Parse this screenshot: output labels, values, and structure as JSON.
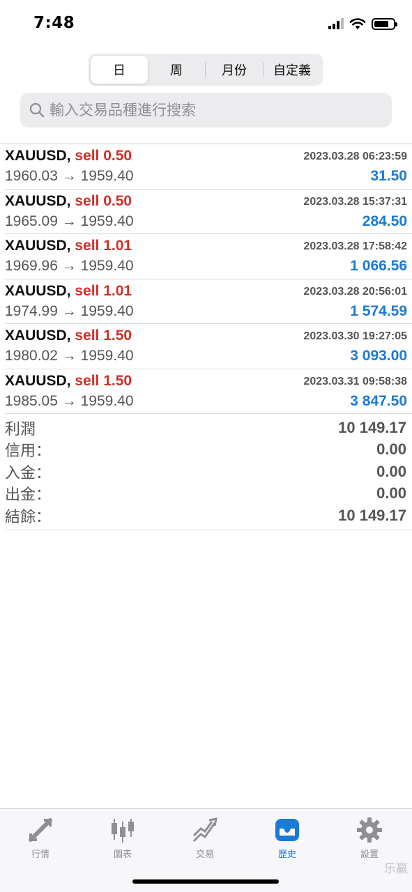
{
  "status": {
    "time": "7:48"
  },
  "segments": [
    "日",
    "周",
    "月份",
    "自定義"
  ],
  "active_segment": 0,
  "search": {
    "placeholder": "輸入交易品種進行搜索"
  },
  "trades": [
    {
      "symbol": "XAUUSD,",
      "side": "sell 0.50",
      "open": "1960.03",
      "arrow": "→",
      "close": "1959.40",
      "time": "2023.03.28 06:23:59",
      "profit": "31.50"
    },
    {
      "symbol": "XAUUSD,",
      "side": "sell 0.50",
      "open": "1965.09",
      "arrow": "→",
      "close": "1959.40",
      "time": "2023.03.28 15:37:31",
      "profit": "284.50"
    },
    {
      "symbol": "XAUUSD,",
      "side": "sell 1.01",
      "open": "1969.96",
      "arrow": "→",
      "close": "1959.40",
      "time": "2023.03.28 17:58:42",
      "profit": "1 066.56"
    },
    {
      "symbol": "XAUUSD,",
      "side": "sell 1.01",
      "open": "1974.99",
      "arrow": "→",
      "close": "1959.40",
      "time": "2023.03.28 20:56:01",
      "profit": "1 574.59"
    },
    {
      "symbol": "XAUUSD,",
      "side": "sell 1.50",
      "open": "1980.02",
      "arrow": "→",
      "close": "1959.40",
      "time": "2023.03.30 19:27:05",
      "profit": "3 093.00"
    },
    {
      "symbol": "XAUUSD,",
      "side": "sell 1.50",
      "open": "1985.05",
      "arrow": "→",
      "close": "1959.40",
      "time": "2023.03.31 09:58:38",
      "profit": "3 847.50"
    }
  ],
  "summary": [
    {
      "label": "利潤",
      "value": "10 149.17"
    },
    {
      "label": "信用：",
      "value": "0.00"
    },
    {
      "label": "入金：",
      "value": "0.00"
    },
    {
      "label": "出金：",
      "value": "0.00"
    },
    {
      "label": "結餘：",
      "value": "10 149.17"
    }
  ],
  "tabs": [
    {
      "label": "行情",
      "icon": "quotes-icon"
    },
    {
      "label": "圖表",
      "icon": "chart-icon"
    },
    {
      "label": "交易",
      "icon": "trade-icon"
    },
    {
      "label": "歷史",
      "icon": "history-icon"
    },
    {
      "label": "設置",
      "icon": "settings-icon"
    }
  ],
  "active_tab": 3,
  "watermark": "乐赢",
  "colors": {
    "sell": "#d0302a",
    "profit": "#1a7ad4",
    "active_tab": "#1a7ad4",
    "inactive_tab": "#8e8e93"
  }
}
